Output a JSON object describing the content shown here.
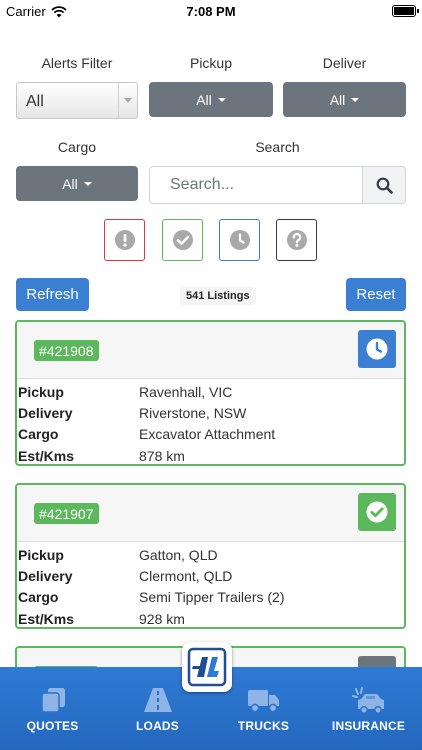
{
  "status_bar": {
    "carrier": "Carrier",
    "time": "7:08 PM"
  },
  "filters": {
    "alerts_label": "Alerts Filter",
    "alerts_value": "All",
    "pickup_label": "Pickup",
    "pickup_value": "All",
    "deliver_label": "Deliver",
    "deliver_value": "All",
    "cargo_label": "Cargo",
    "cargo_value": "All",
    "search_label": "Search",
    "search_placeholder": "Search...",
    "search_value": ""
  },
  "status_filters": [
    {
      "icon": "alert-icon",
      "color": "#dc3545"
    },
    {
      "icon": "check-icon",
      "color": "#5cb85c"
    },
    {
      "icon": "clock-icon",
      "color": "#3a7fd1"
    },
    {
      "icon": "question-icon",
      "color": "#343a40"
    }
  ],
  "toolbar": {
    "refresh_label": "Refresh",
    "listings_count": "541 Listings",
    "reset_label": "Reset"
  },
  "listing_fields": {
    "pickup": "Pickup",
    "delivery": "Delivery",
    "cargo": "Cargo",
    "est_kms": "Est/Kms"
  },
  "listings": [
    {
      "id": "#421908",
      "status_icon": "clock-icon",
      "status_color": "#3a7fd1",
      "pickup": "Ravenhall, VIC",
      "delivery": "Riverstone, NSW",
      "cargo": "Excavator Attachment",
      "est_kms": "878 km"
    },
    {
      "id": "#421907",
      "status_icon": "check-icon",
      "status_color": "#5cb85c",
      "pickup": "Gatton, QLD",
      "delivery": "Clermont, QLD",
      "cargo": "Semi Tipper Trailers (2)",
      "est_kms": "928 km"
    }
  ],
  "tab_bar": {
    "tabs": [
      {
        "label": "QUOTES",
        "icon": "quotes-icon"
      },
      {
        "label": "LOADS",
        "icon": "road-icon"
      },
      {
        "label": "TRUCKS",
        "icon": "truck-icon"
      },
      {
        "label": "INSURANCE",
        "icon": "car-crash-icon"
      }
    ],
    "logo_icon": "app-logo-icon"
  },
  "colors": {
    "primary": "#3a7fd1",
    "secondary": "#6c757d",
    "success": "#5cb85c",
    "danger": "#dc3545",
    "tab_bar": "#2a72cb"
  }
}
